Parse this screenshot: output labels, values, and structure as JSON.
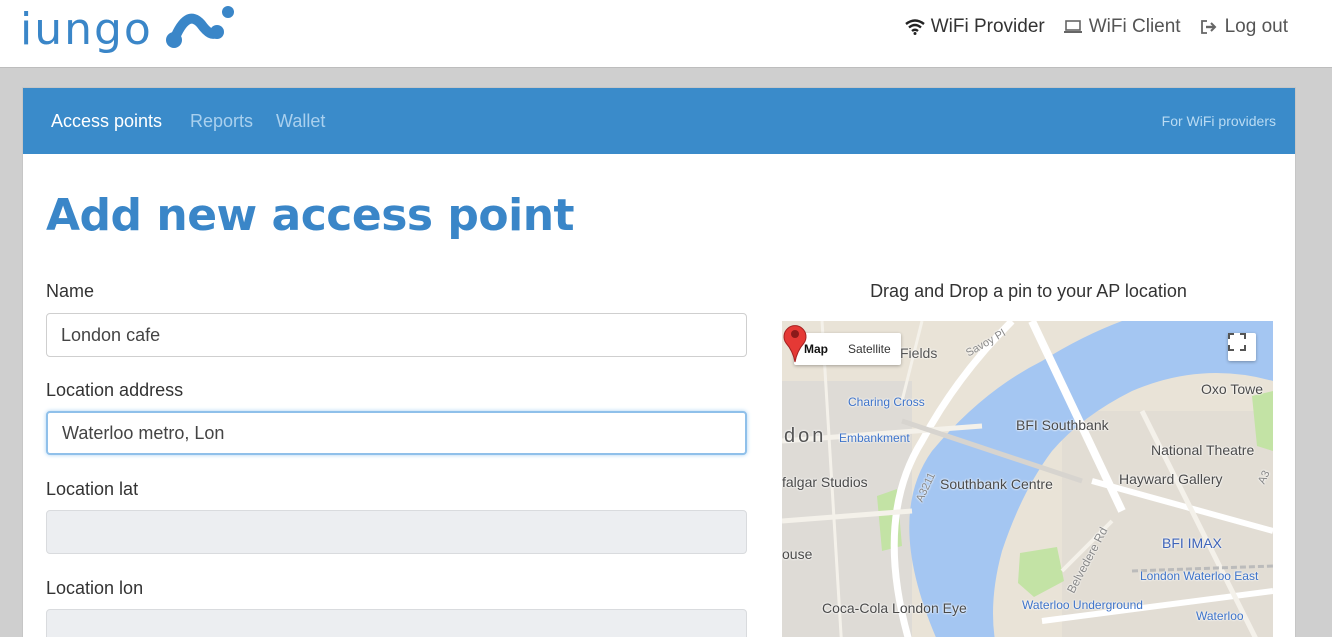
{
  "header": {
    "logo_text": "iungo",
    "nav": [
      {
        "label": "WiFi Provider",
        "icon": "wifi-icon"
      },
      {
        "label": "WiFi Client",
        "icon": "laptop-icon"
      },
      {
        "label": "Log out",
        "icon": "logout-icon"
      }
    ]
  },
  "tabs": [
    {
      "label": "Access points",
      "active": true
    },
    {
      "label": "Reports",
      "active": false
    },
    {
      "label": "Wallet",
      "active": false
    }
  ],
  "for_providers": "For WiFi providers",
  "page_title": "Add new access point",
  "form": {
    "name_label": "Name",
    "name_value": "London cafe",
    "address_label": "Location address",
    "address_value": "Waterloo metro, Lon",
    "lat_label": "Location lat",
    "lat_value": "",
    "lon_label": "Location lon",
    "lon_value": ""
  },
  "map": {
    "caption": "Drag and Drop a pin to your AP location",
    "type_map": "Map",
    "type_satellite": "Satellite",
    "labels": {
      "fields": "Fields",
      "savoy": "Savoy Pl",
      "charing_cross": "Charing Cross",
      "don": "don",
      "embankment": "Embankment",
      "bfi_southbank": "BFI Southbank",
      "oxo_tower": "Oxo Towe",
      "national_theatre": "National Theatre",
      "falgar": "falgar Studios",
      "southbank_centre": "Southbank Centre",
      "hayward": "Hayward Gallery",
      "a3211": "A3211",
      "belvedere": "Belvedere Rd",
      "bfi_imax": "BFI IMAX",
      "ouse": "ouse",
      "london_waterloo_east": "London Waterloo East",
      "coca_cola": "Coca-Cola London Eye",
      "waterloo_underground": "Waterloo Underground",
      "waterloo": "Waterloo",
      "a3": "A3"
    }
  },
  "colors": {
    "brand": "#3a86c8",
    "nav_bar": "#3a8bca",
    "river": "#9fc3f0",
    "park": "#bfe0a3"
  }
}
